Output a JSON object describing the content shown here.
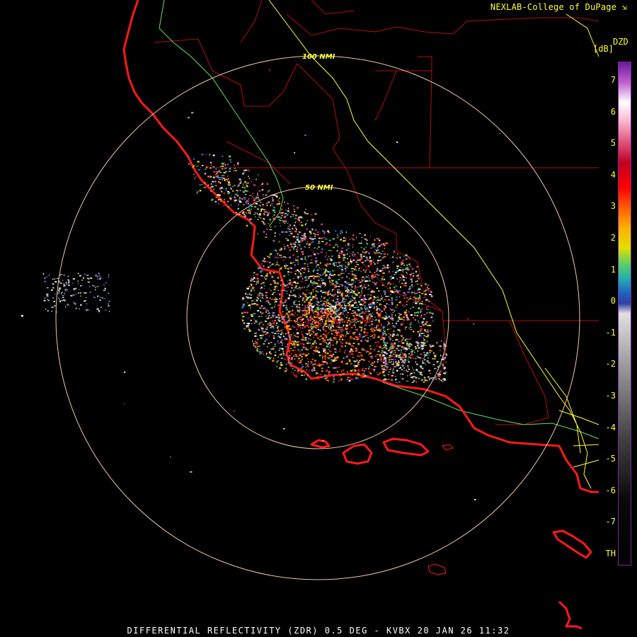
{
  "credit": "NEXLAB-College of DuPage",
  "credit_icon": "external-link-icon",
  "legend": {
    "title": "DZD",
    "unit": "[dB]",
    "ticks": [
      "7",
      "6",
      "5",
      "4",
      "3",
      "2",
      "1",
      "0",
      "-1",
      "-2",
      "-3",
      "-4",
      "-5",
      "-6",
      "-7",
      "TH"
    ]
  },
  "range_rings": [
    {
      "label": "100 NMI",
      "range_nmi": 100
    },
    {
      "label": "50 NMI",
      "range_nmi": 50
    }
  ],
  "footer": "DIFFERENTIAL REFLECTIVITY (ZDR) 0.5 DEG - KVBX 20 JAN 26 11:32",
  "colors": {
    "background": "#000000",
    "coastline": "#ff1a1a",
    "county": "#b01010",
    "highway": "#ffff33",
    "river": "#66dd66",
    "ring": "#f0c8a0",
    "text": "#ffff33"
  }
}
